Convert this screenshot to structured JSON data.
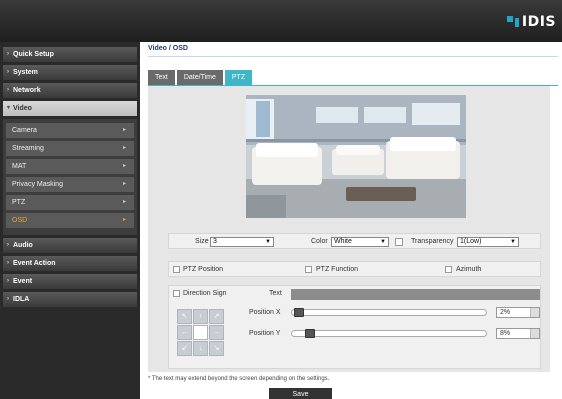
{
  "brand": {
    "name": "IDIS",
    "accent": "#1fa7c4"
  },
  "sidebar": {
    "items": [
      {
        "label": "Quick Setup"
      },
      {
        "label": "System"
      },
      {
        "label": "Network"
      },
      {
        "label": "Video"
      },
      {
        "label": "Audio"
      },
      {
        "label": "Event Action"
      },
      {
        "label": "Event"
      },
      {
        "label": "IDLA"
      }
    ],
    "video_submenu": [
      {
        "label": "Camera"
      },
      {
        "label": "Streaming"
      },
      {
        "label": "MAT"
      },
      {
        "label": "Privacy Masking"
      },
      {
        "label": "PTZ"
      },
      {
        "label": "OSD"
      }
    ],
    "selected_sub": "OSD",
    "selected_color": "#f0a236"
  },
  "header": {
    "title": "Video / OSD"
  },
  "tabs": [
    {
      "label": "Text"
    },
    {
      "label": "Date/Time"
    },
    {
      "label": "PTZ"
    }
  ],
  "active_tab": "PTZ",
  "settings": {
    "size_label": "Size",
    "size_value": "3",
    "color_label": "Color",
    "color_value": "White",
    "transparency_label": "Transparency",
    "transparency_value": "1(Low)",
    "ptz_position_label": "PTZ Position",
    "ptz_function_label": "PTZ Function",
    "azimuth_label": "Azimuth",
    "direction_sign_label": "Direction Sign",
    "text_label": "Text",
    "position_x_label": "Position X",
    "position_x_value": "2%",
    "position_y_label": "Position Y",
    "position_y_value": "8%"
  },
  "note": "* The text may extend beyond the screen depending on the settings.",
  "save_label": "Save"
}
